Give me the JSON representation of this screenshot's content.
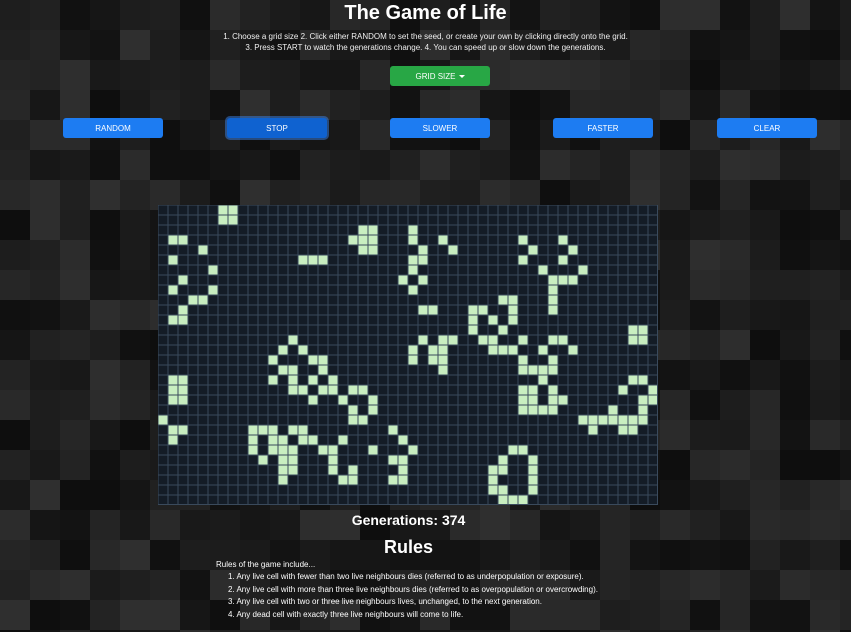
{
  "header": {
    "title": "The Game of Life",
    "instructions_line1": "1. Choose a grid size 2. Click either RANDOM to set the seed, or create your own by clicking directly onto the grid.",
    "instructions_line2": "3. Press START to watch the generations change. 4. You can speed up or slow down the generations."
  },
  "grid_size_button": {
    "label": "GRID SIZE",
    "icon": "caret-down-icon",
    "color": "#28a745"
  },
  "controls": {
    "random_label": "RANDOM",
    "stop_label": "STOP",
    "slower_label": "SLOWER",
    "faster_label": "FASTER",
    "clear_label": "CLEAR"
  },
  "colors": {
    "accent": "#1d7cf2",
    "live_cell": "#c8eec0",
    "grid_line": "#3a4a5c",
    "grid_bg": "#141c26"
  },
  "grid": {
    "cols": 50,
    "rows": 30,
    "live_cells": [
      [
        6,
        0
      ],
      [
        7,
        0
      ],
      [
        6,
        1
      ],
      [
        7,
        1
      ],
      [
        1,
        3
      ],
      [
        2,
        3
      ],
      [
        4,
        4
      ],
      [
        1,
        5
      ],
      [
        5,
        6
      ],
      [
        2,
        7
      ],
      [
        1,
        8
      ],
      [
        5,
        8
      ],
      [
        3,
        9
      ],
      [
        4,
        9
      ],
      [
        2,
        10
      ],
      [
        1,
        11
      ],
      [
        2,
        11
      ],
      [
        20,
        2
      ],
      [
        21,
        2
      ],
      [
        19,
        3
      ],
      [
        20,
        3
      ],
      [
        21,
        3
      ],
      [
        20,
        4
      ],
      [
        21,
        4
      ],
      [
        25,
        2
      ],
      [
        25,
        3
      ],
      [
        28,
        3
      ],
      [
        26,
        4
      ],
      [
        29,
        4
      ],
      [
        14,
        5
      ],
      [
        15,
        5
      ],
      [
        16,
        5
      ],
      [
        25,
        5
      ],
      [
        26,
        5
      ],
      [
        25,
        6
      ],
      [
        24,
        7
      ],
      [
        26,
        7
      ],
      [
        25,
        8
      ],
      [
        36,
        3
      ],
      [
        40,
        3
      ],
      [
        37,
        4
      ],
      [
        41,
        4
      ],
      [
        36,
        5
      ],
      [
        40,
        5
      ],
      [
        38,
        6
      ],
      [
        42,
        6
      ],
      [
        39,
        7
      ],
      [
        40,
        7
      ],
      [
        41,
        7
      ],
      [
        39,
        8
      ],
      [
        39,
        9
      ],
      [
        39,
        10
      ],
      [
        34,
        9
      ],
      [
        35,
        9
      ],
      [
        35,
        10
      ],
      [
        35,
        11
      ],
      [
        26,
        10
      ],
      [
        27,
        10
      ],
      [
        31,
        10
      ],
      [
        32,
        10
      ],
      [
        31,
        11
      ],
      [
        33,
        11
      ],
      [
        31,
        12
      ],
      [
        34,
        12
      ],
      [
        26,
        13
      ],
      [
        28,
        13
      ],
      [
        29,
        13
      ],
      [
        32,
        13
      ],
      [
        33,
        13
      ],
      [
        36,
        13
      ],
      [
        39,
        13
      ],
      [
        40,
        13
      ],
      [
        25,
        14
      ],
      [
        27,
        14
      ],
      [
        28,
        14
      ],
      [
        33,
        14
      ],
      [
        34,
        14
      ],
      [
        35,
        14
      ],
      [
        38,
        14
      ],
      [
        41,
        14
      ],
      [
        25,
        15
      ],
      [
        27,
        15
      ],
      [
        28,
        15
      ],
      [
        36,
        15
      ],
      [
        39,
        15
      ],
      [
        28,
        16
      ],
      [
        36,
        16
      ],
      [
        37,
        16
      ],
      [
        38,
        16
      ],
      [
        39,
        16
      ],
      [
        47,
        12
      ],
      [
        48,
        12
      ],
      [
        47,
        13
      ],
      [
        48,
        13
      ],
      [
        13,
        13
      ],
      [
        12,
        14
      ],
      [
        14,
        14
      ],
      [
        11,
        15
      ],
      [
        15,
        15
      ],
      [
        16,
        15
      ],
      [
        12,
        16
      ],
      [
        13,
        16
      ],
      [
        16,
        16
      ],
      [
        11,
        17
      ],
      [
        13,
        17
      ],
      [
        15,
        17
      ],
      [
        17,
        17
      ],
      [
        14,
        18
      ],
      [
        13,
        18
      ],
      [
        16,
        18
      ],
      [
        17,
        18
      ],
      [
        19,
        18
      ],
      [
        20,
        18
      ],
      [
        15,
        19
      ],
      [
        18,
        19
      ],
      [
        21,
        19
      ],
      [
        19,
        20
      ],
      [
        21,
        20
      ],
      [
        20,
        21
      ],
      [
        19,
        21
      ],
      [
        1,
        17
      ],
      [
        2,
        17
      ],
      [
        1,
        18
      ],
      [
        2,
        18
      ],
      [
        1,
        19
      ],
      [
        2,
        19
      ],
      [
        0,
        21
      ],
      [
        1,
        22
      ],
      [
        2,
        22
      ],
      [
        1,
        23
      ],
      [
        38,
        17
      ],
      [
        36,
        18
      ],
      [
        37,
        18
      ],
      [
        39,
        18
      ],
      [
        36,
        19
      ],
      [
        37,
        19
      ],
      [
        39,
        19
      ],
      [
        40,
        19
      ],
      [
        36,
        20
      ],
      [
        37,
        20
      ],
      [
        38,
        20
      ],
      [
        39,
        20
      ],
      [
        47,
        17
      ],
      [
        48,
        17
      ],
      [
        46,
        18
      ],
      [
        49,
        18
      ],
      [
        48,
        19
      ],
      [
        49,
        19
      ],
      [
        45,
        20
      ],
      [
        48,
        20
      ],
      [
        42,
        21
      ],
      [
        43,
        21
      ],
      [
        44,
        21
      ],
      [
        45,
        21
      ],
      [
        46,
        21
      ],
      [
        47,
        21
      ],
      [
        48,
        21
      ],
      [
        43,
        22
      ],
      [
        46,
        22
      ],
      [
        47,
        22
      ],
      [
        9,
        22
      ],
      [
        10,
        22
      ],
      [
        11,
        22
      ],
      [
        13,
        22
      ],
      [
        14,
        22
      ],
      [
        23,
        22
      ],
      [
        9,
        23
      ],
      [
        11,
        23
      ],
      [
        12,
        23
      ],
      [
        14,
        23
      ],
      [
        15,
        23
      ],
      [
        18,
        23
      ],
      [
        24,
        23
      ],
      [
        9,
        24
      ],
      [
        11,
        24
      ],
      [
        12,
        24
      ],
      [
        13,
        24
      ],
      [
        16,
        24
      ],
      [
        17,
        24
      ],
      [
        21,
        24
      ],
      [
        25,
        24
      ],
      [
        10,
        25
      ],
      [
        12,
        25
      ],
      [
        13,
        25
      ],
      [
        17,
        25
      ],
      [
        23,
        25
      ],
      [
        24,
        25
      ],
      [
        12,
        26
      ],
      [
        13,
        26
      ],
      [
        17,
        26
      ],
      [
        19,
        26
      ],
      [
        24,
        26
      ],
      [
        12,
        27
      ],
      [
        18,
        27
      ],
      [
        19,
        27
      ],
      [
        23,
        27
      ],
      [
        24,
        27
      ],
      [
        35,
        24
      ],
      [
        36,
        24
      ],
      [
        34,
        25
      ],
      [
        37,
        25
      ],
      [
        33,
        26
      ],
      [
        34,
        26
      ],
      [
        37,
        26
      ],
      [
        33,
        27
      ],
      [
        37,
        27
      ],
      [
        33,
        28
      ],
      [
        34,
        28
      ],
      [
        37,
        28
      ],
      [
        34,
        29
      ],
      [
        35,
        29
      ],
      [
        36,
        29
      ]
    ]
  },
  "generations": {
    "label": "Generations:",
    "count": "374"
  },
  "rules": {
    "title": "Rules",
    "intro": "Rules of the game include...",
    "items": [
      "1. Any live cell with fewer than two live neighbours dies (referred to as underpopulation or exposure).",
      "2. Any live cell with more than three live neighbours dies (referred to as overpopulation or overcrowding).",
      "3. Any live cell with two or three live neighbours lives, unchanged, to the next generation.",
      "4. Any dead cell with exactly three live neighbours will come to life."
    ]
  }
}
